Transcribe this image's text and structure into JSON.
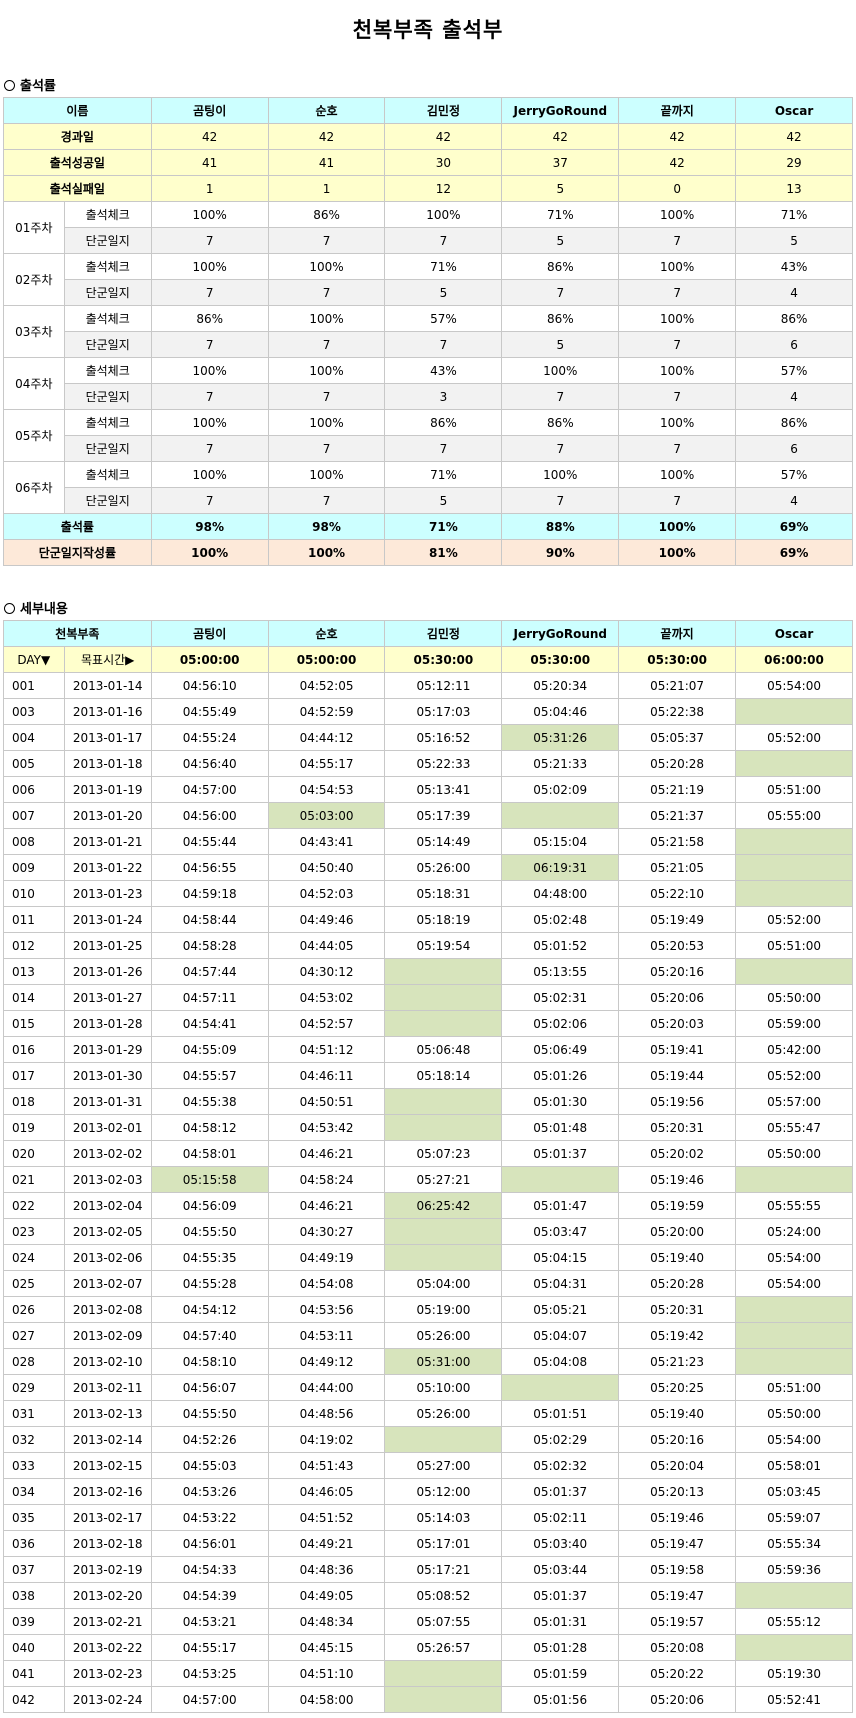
{
  "page_title": "천복부족 출석부",
  "section1_title": "출석률",
  "section2_title": "세부내용",
  "names": [
    "곰팅이",
    "순호",
    "김민정",
    "JerryGoRound",
    "끝까지",
    "Oscar"
  ],
  "rates": {
    "header_label": "이름",
    "elapsed_label": "경과일",
    "elapsed": [
      "42",
      "42",
      "42",
      "42",
      "42",
      "42"
    ],
    "success_label": "출석성공일",
    "success": [
      "41",
      "41",
      "30",
      "37",
      "42",
      "29"
    ],
    "fail_label": "출석실패일",
    "fail": [
      "1",
      "1",
      "12",
      "5",
      "0",
      "13"
    ],
    "check_label": "출석체크",
    "journal_label": "단군일지",
    "weeks": [
      {
        "label": "01주차",
        "check": [
          "100%",
          "86%",
          "100%",
          "71%",
          "100%",
          "71%"
        ],
        "journal": [
          "7",
          "7",
          "7",
          "5",
          "7",
          "5"
        ]
      },
      {
        "label": "02주차",
        "check": [
          "100%",
          "100%",
          "71%",
          "86%",
          "100%",
          "43%"
        ],
        "journal": [
          "7",
          "7",
          "5",
          "7",
          "7",
          "4"
        ]
      },
      {
        "label": "03주차",
        "check": [
          "86%",
          "100%",
          "57%",
          "86%",
          "100%",
          "86%"
        ],
        "journal": [
          "7",
          "7",
          "7",
          "5",
          "7",
          "6"
        ]
      },
      {
        "label": "04주차",
        "check": [
          "100%",
          "100%",
          "43%",
          "100%",
          "100%",
          "57%"
        ],
        "journal": [
          "7",
          "7",
          "3",
          "7",
          "7",
          "4"
        ]
      },
      {
        "label": "05주차",
        "check": [
          "100%",
          "100%",
          "86%",
          "86%",
          "100%",
          "86%"
        ],
        "journal": [
          "7",
          "7",
          "7",
          "7",
          "7",
          "6"
        ]
      },
      {
        "label": "06주차",
        "check": [
          "100%",
          "100%",
          "71%",
          "100%",
          "100%",
          "57%"
        ],
        "journal": [
          "7",
          "7",
          "5",
          "7",
          "7",
          "4"
        ]
      }
    ],
    "total_label": "출석률",
    "total": [
      "98%",
      "98%",
      "71%",
      "88%",
      "100%",
      "69%"
    ],
    "journal_rate_label": "단군일지작성률",
    "journal_rate": [
      "100%",
      "100%",
      "81%",
      "90%",
      "100%",
      "69%"
    ]
  },
  "details": {
    "header_label": "천복부족",
    "day_label": "DAY▼",
    "target_label": "목표시간▶",
    "targets": [
      "05:00:00",
      "05:00:00",
      "05:30:00",
      "05:30:00",
      "05:30:00",
      "06:00:00"
    ],
    "miss_color": "#d7e4bc",
    "rows": [
      {
        "day": "001",
        "date": "2013-01-14",
        "t": [
          "04:56:10",
          "04:52:05",
          "05:12:11",
          "05:20:34",
          "05:21:07",
          "05:54:00"
        ],
        "miss": []
      },
      {
        "day": "003",
        "date": "2013-01-16",
        "t": [
          "04:55:49",
          "04:52:59",
          "05:17:03",
          "05:04:46",
          "05:22:38",
          ""
        ],
        "miss": [
          5
        ]
      },
      {
        "day": "004",
        "date": "2013-01-17",
        "t": [
          "04:55:24",
          "04:44:12",
          "05:16:52",
          "05:31:26",
          "05:05:37",
          "05:52:00"
        ],
        "miss": [
          3
        ]
      },
      {
        "day": "005",
        "date": "2013-01-18",
        "t": [
          "04:56:40",
          "04:55:17",
          "05:22:33",
          "05:21:33",
          "05:20:28",
          ""
        ],
        "miss": [
          5
        ]
      },
      {
        "day": "006",
        "date": "2013-01-19",
        "t": [
          "04:57:00",
          "04:54:53",
          "05:13:41",
          "05:02:09",
          "05:21:19",
          "05:51:00"
        ],
        "miss": []
      },
      {
        "day": "007",
        "date": "2013-01-20",
        "t": [
          "04:56:00",
          "05:03:00",
          "05:17:39",
          "",
          "05:21:37",
          "05:55:00"
        ],
        "miss": [
          1,
          3
        ]
      },
      {
        "day": "008",
        "date": "2013-01-21",
        "t": [
          "04:55:44",
          "04:43:41",
          "05:14:49",
          "05:15:04",
          "05:21:58",
          ""
        ],
        "miss": [
          5
        ]
      },
      {
        "day": "009",
        "date": "2013-01-22",
        "t": [
          "04:56:55",
          "04:50:40",
          "05:26:00",
          "06:19:31",
          "05:21:05",
          ""
        ],
        "miss": [
          3,
          5
        ]
      },
      {
        "day": "010",
        "date": "2013-01-23",
        "t": [
          "04:59:18",
          "04:52:03",
          "05:18:31",
          "04:48:00",
          "05:22:10",
          ""
        ],
        "miss": [
          5
        ]
      },
      {
        "day": "011",
        "date": "2013-01-24",
        "t": [
          "04:58:44",
          "04:49:46",
          "05:18:19",
          "05:02:48",
          "05:19:49",
          "05:52:00"
        ],
        "miss": []
      },
      {
        "day": "012",
        "date": "2013-01-25",
        "t": [
          "04:58:28",
          "04:44:05",
          "05:19:54",
          "05:01:52",
          "05:20:53",
          "05:51:00"
        ],
        "miss": []
      },
      {
        "day": "013",
        "date": "2013-01-26",
        "t": [
          "04:57:44",
          "04:30:12",
          "",
          "05:13:55",
          "05:20:16",
          ""
        ],
        "miss": [
          2,
          5
        ]
      },
      {
        "day": "014",
        "date": "2013-01-27",
        "t": [
          "04:57:11",
          "04:53:02",
          "",
          "05:02:31",
          "05:20:06",
          "05:50:00"
        ],
        "miss": [
          2
        ]
      },
      {
        "day": "015",
        "date": "2013-01-28",
        "t": [
          "04:54:41",
          "04:52:57",
          "",
          "05:02:06",
          "05:20:03",
          "05:59:00"
        ],
        "miss": [
          2
        ]
      },
      {
        "day": "016",
        "date": "2013-01-29",
        "t": [
          "04:55:09",
          "04:51:12",
          "05:06:48",
          "05:06:49",
          "05:19:41",
          "05:42:00"
        ],
        "miss": []
      },
      {
        "day": "017",
        "date": "2013-01-30",
        "t": [
          "04:55:57",
          "04:46:11",
          "05:18:14",
          "05:01:26",
          "05:19:44",
          "05:52:00"
        ],
        "miss": []
      },
      {
        "day": "018",
        "date": "2013-01-31",
        "t": [
          "04:55:38",
          "04:50:51",
          "",
          "05:01:30",
          "05:19:56",
          "05:57:00"
        ],
        "miss": [
          2
        ]
      },
      {
        "day": "019",
        "date": "2013-02-01",
        "t": [
          "04:58:12",
          "04:53:42",
          "",
          "05:01:48",
          "05:20:31",
          "05:55:47"
        ],
        "miss": [
          2
        ]
      },
      {
        "day": "020",
        "date": "2013-02-02",
        "t": [
          "04:58:01",
          "04:46:21",
          "05:07:23",
          "05:01:37",
          "05:20:02",
          "05:50:00"
        ],
        "miss": []
      },
      {
        "day": "021",
        "date": "2013-02-03",
        "t": [
          "05:15:58",
          "04:58:24",
          "05:27:21",
          "",
          "05:19:46",
          ""
        ],
        "miss": [
          0,
          3,
          5
        ]
      },
      {
        "day": "022",
        "date": "2013-02-04",
        "t": [
          "04:56:09",
          "04:46:21",
          "06:25:42",
          "05:01:47",
          "05:19:59",
          "05:55:55"
        ],
        "miss": [
          2
        ]
      },
      {
        "day": "023",
        "date": "2013-02-05",
        "t": [
          "04:55:50",
          "04:30:27",
          "",
          "05:03:47",
          "05:20:00",
          "05:24:00"
        ],
        "miss": [
          2
        ]
      },
      {
        "day": "024",
        "date": "2013-02-06",
        "t": [
          "04:55:35",
          "04:49:19",
          "",
          "05:04:15",
          "05:19:40",
          "05:54:00"
        ],
        "miss": [
          2
        ]
      },
      {
        "day": "025",
        "date": "2013-02-07",
        "t": [
          "04:55:28",
          "04:54:08",
          "05:04:00",
          "05:04:31",
          "05:20:28",
          "05:54:00"
        ],
        "miss": []
      },
      {
        "day": "026",
        "date": "2013-02-08",
        "t": [
          "04:54:12",
          "04:53:56",
          "05:19:00",
          "05:05:21",
          "05:20:31",
          ""
        ],
        "miss": [
          5
        ]
      },
      {
        "day": "027",
        "date": "2013-02-09",
        "t": [
          "04:57:40",
          "04:53:11",
          "05:26:00",
          "05:04:07",
          "05:19:42",
          ""
        ],
        "miss": [
          5
        ]
      },
      {
        "day": "028",
        "date": "2013-02-10",
        "t": [
          "04:58:10",
          "04:49:12",
          "05:31:00",
          "05:04:08",
          "05:21:23",
          ""
        ],
        "miss": [
          2,
          5
        ]
      },
      {
        "day": "029",
        "date": "2013-02-11",
        "t": [
          "04:56:07",
          "04:44:00",
          "05:10:00",
          "",
          "05:20:25",
          "05:51:00"
        ],
        "miss": [
          3
        ]
      },
      {
        "day": "031",
        "date": "2013-02-13",
        "t": [
          "04:55:50",
          "04:48:56",
          "05:26:00",
          "05:01:51",
          "05:19:40",
          "05:50:00"
        ],
        "miss": []
      },
      {
        "day": "032",
        "date": "2013-02-14",
        "t": [
          "04:52:26",
          "04:19:02",
          "",
          "05:02:29",
          "05:20:16",
          "05:54:00"
        ],
        "miss": [
          2
        ]
      },
      {
        "day": "033",
        "date": "2013-02-15",
        "t": [
          "04:55:03",
          "04:51:43",
          "05:27:00",
          "05:02:32",
          "05:20:04",
          "05:58:01"
        ],
        "miss": []
      },
      {
        "day": "034",
        "date": "2013-02-16",
        "t": [
          "04:53:26",
          "04:46:05",
          "05:12:00",
          "05:01:37",
          "05:20:13",
          "05:03:45"
        ],
        "miss": []
      },
      {
        "day": "035",
        "date": "2013-02-17",
        "t": [
          "04:53:22",
          "04:51:52",
          "05:14:03",
          "05:02:11",
          "05:19:46",
          "05:59:07"
        ],
        "miss": []
      },
      {
        "day": "036",
        "date": "2013-02-18",
        "t": [
          "04:56:01",
          "04:49:21",
          "05:17:01",
          "05:03:40",
          "05:19:47",
          "05:55:34"
        ],
        "miss": []
      },
      {
        "day": "037",
        "date": "2013-02-19",
        "t": [
          "04:54:33",
          "04:48:36",
          "05:17:21",
          "05:03:44",
          "05:19:58",
          "05:59:36"
        ],
        "miss": []
      },
      {
        "day": "038",
        "date": "2013-02-20",
        "t": [
          "04:54:39",
          "04:49:05",
          "05:08:52",
          "05:01:37",
          "05:19:47",
          ""
        ],
        "miss": [
          5
        ]
      },
      {
        "day": "039",
        "date": "2013-02-21",
        "t": [
          "04:53:21",
          "04:48:34",
          "05:07:55",
          "05:01:31",
          "05:19:57",
          "05:55:12"
        ],
        "miss": []
      },
      {
        "day": "040",
        "date": "2013-02-22",
        "t": [
          "04:55:17",
          "04:45:15",
          "05:26:57",
          "05:01:28",
          "05:20:08",
          ""
        ],
        "miss": [
          5
        ]
      },
      {
        "day": "041",
        "date": "2013-02-23",
        "t": [
          "04:53:25",
          "04:51:10",
          "",
          "05:01:59",
          "05:20:22",
          "05:19:30"
        ],
        "miss": [
          2
        ]
      },
      {
        "day": "042",
        "date": "2013-02-24",
        "t": [
          "04:57:00",
          "04:58:00",
          "",
          "05:01:56",
          "05:20:06",
          "05:52:41"
        ],
        "miss": [
          2
        ]
      }
    ]
  }
}
